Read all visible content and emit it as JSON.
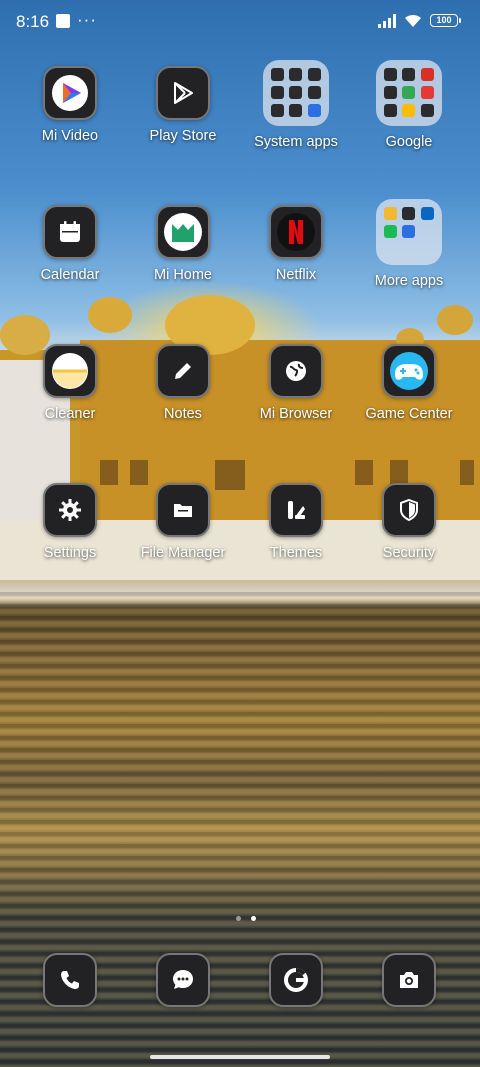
{
  "status_bar": {
    "time": "8:16",
    "battery": "100"
  },
  "apps": {
    "mi_video": "Mi Video",
    "play_store": "Play Store",
    "system_apps": "System apps",
    "google": "Google",
    "calendar": "Calendar",
    "mi_home": "Mi Home",
    "netflix": "Netflix",
    "more_apps": "More apps",
    "cleaner": "Cleaner",
    "notes": "Notes",
    "mi_browser": "Mi Browser",
    "game_center": "Game Center",
    "settings": "Settings",
    "file_manager": "File Manager",
    "themes": "Themes",
    "security": "Security"
  },
  "dock": [
    "phone-icon",
    "messaging-icon",
    "chrome-icon",
    "camera-icon"
  ],
  "page_indicator": {
    "pages": 2,
    "active": 2
  }
}
